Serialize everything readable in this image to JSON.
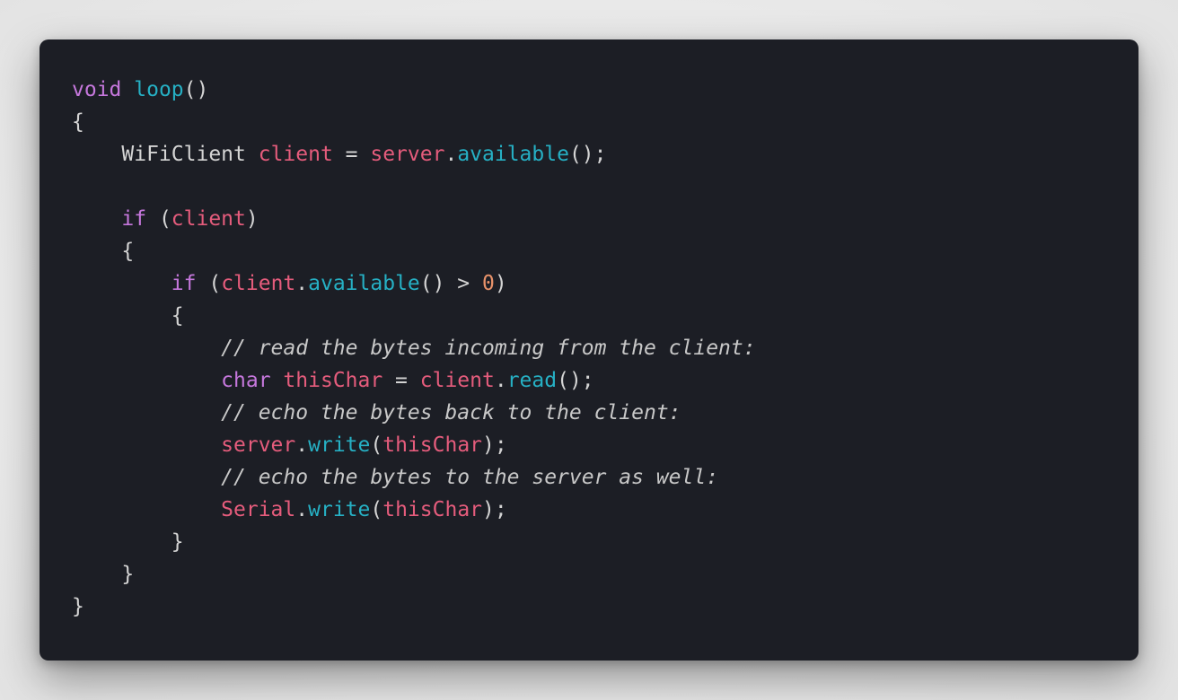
{
  "code": {
    "lines": [
      [
        {
          "t": "void",
          "c": "keyword"
        },
        {
          "t": " ",
          "c": "plain"
        },
        {
          "t": "loop",
          "c": "function"
        },
        {
          "t": "()",
          "c": "plain"
        }
      ],
      [
        {
          "t": "{",
          "c": "plain"
        }
      ],
      [
        {
          "t": "    WiFiClient ",
          "c": "plain"
        },
        {
          "t": "client",
          "c": "variable"
        },
        {
          "t": " = ",
          "c": "plain"
        },
        {
          "t": "server",
          "c": "variable"
        },
        {
          "t": ".",
          "c": "plain"
        },
        {
          "t": "available",
          "c": "function"
        },
        {
          "t": "();",
          "c": "plain"
        }
      ],
      [],
      [
        {
          "t": "    ",
          "c": "plain"
        },
        {
          "t": "if",
          "c": "keyword"
        },
        {
          "t": " (",
          "c": "plain"
        },
        {
          "t": "client",
          "c": "variable"
        },
        {
          "t": ")",
          "c": "plain"
        }
      ],
      [
        {
          "t": "    {",
          "c": "plain"
        }
      ],
      [
        {
          "t": "        ",
          "c": "plain"
        },
        {
          "t": "if",
          "c": "keyword"
        },
        {
          "t": " (",
          "c": "plain"
        },
        {
          "t": "client",
          "c": "variable"
        },
        {
          "t": ".",
          "c": "plain"
        },
        {
          "t": "available",
          "c": "function"
        },
        {
          "t": "() > ",
          "c": "plain"
        },
        {
          "t": "0",
          "c": "number"
        },
        {
          "t": ")",
          "c": "plain"
        }
      ],
      [
        {
          "t": "        {",
          "c": "plain"
        }
      ],
      [
        {
          "t": "            ",
          "c": "plain"
        },
        {
          "t": "// read the bytes incoming from the client:",
          "c": "comment"
        }
      ],
      [
        {
          "t": "            ",
          "c": "plain"
        },
        {
          "t": "char",
          "c": "keyword"
        },
        {
          "t": " ",
          "c": "plain"
        },
        {
          "t": "thisChar",
          "c": "variable"
        },
        {
          "t": " = ",
          "c": "plain"
        },
        {
          "t": "client",
          "c": "variable"
        },
        {
          "t": ".",
          "c": "plain"
        },
        {
          "t": "read",
          "c": "function"
        },
        {
          "t": "();",
          "c": "plain"
        }
      ],
      [
        {
          "t": "            ",
          "c": "plain"
        },
        {
          "t": "// echo the bytes back to the client:",
          "c": "comment"
        }
      ],
      [
        {
          "t": "            ",
          "c": "plain"
        },
        {
          "t": "server",
          "c": "variable"
        },
        {
          "t": ".",
          "c": "plain"
        },
        {
          "t": "write",
          "c": "function"
        },
        {
          "t": "(",
          "c": "plain"
        },
        {
          "t": "thisChar",
          "c": "variable"
        },
        {
          "t": ");",
          "c": "plain"
        }
      ],
      [
        {
          "t": "            ",
          "c": "plain"
        },
        {
          "t": "// echo the bytes to the server as well:",
          "c": "comment"
        }
      ],
      [
        {
          "t": "            ",
          "c": "plain"
        },
        {
          "t": "Serial",
          "c": "variable"
        },
        {
          "t": ".",
          "c": "plain"
        },
        {
          "t": "write",
          "c": "function"
        },
        {
          "t": "(",
          "c": "plain"
        },
        {
          "t": "thisChar",
          "c": "variable"
        },
        {
          "t": ");",
          "c": "plain"
        }
      ],
      [
        {
          "t": "        }",
          "c": "plain"
        }
      ],
      [
        {
          "t": "    }",
          "c": "plain"
        }
      ],
      [
        {
          "t": "}",
          "c": "plain"
        }
      ]
    ]
  },
  "colors": {
    "background": "#1c1e25",
    "keyword": "#c678dd",
    "function": "#26b0c4",
    "variable": "#e55c7c",
    "number": "#e8926a",
    "comment": "#c8c8c8",
    "plain": "#d4d4d4"
  }
}
